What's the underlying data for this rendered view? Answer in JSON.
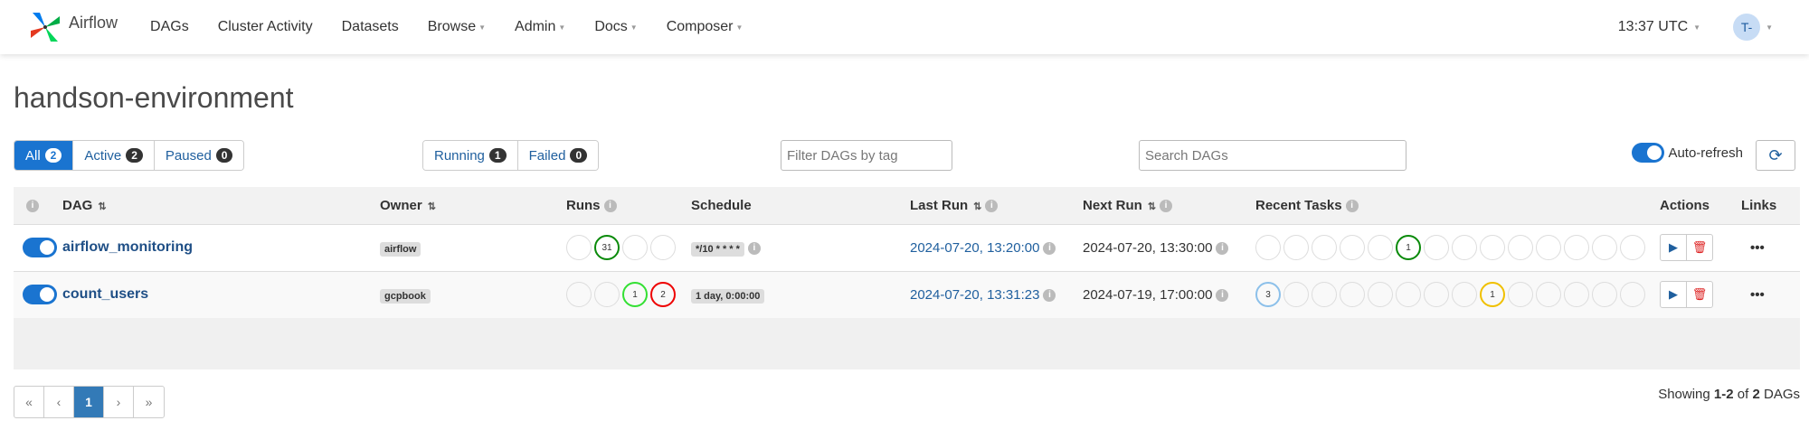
{
  "nav": {
    "brand": "Airflow",
    "items": [
      "DAGs",
      "Cluster Activity",
      "Datasets",
      "Browse",
      "Admin",
      "Docs",
      "Composer"
    ],
    "clock": "13:37 UTC",
    "user_initials": "T-"
  },
  "page_title": "handson-environment",
  "status_filters": [
    {
      "label": "All",
      "count": "2",
      "active": true
    },
    {
      "label": "Active",
      "count": "2"
    },
    {
      "label": "Paused",
      "count": "0"
    }
  ],
  "run_filters": [
    {
      "label": "Running",
      "count": "1"
    },
    {
      "label": "Failed",
      "count": "0"
    }
  ],
  "tag_filter_placeholder": "Filter DAGs by tag",
  "search_placeholder": "Search DAGs",
  "autorefresh_label": "Auto-refresh",
  "columns": {
    "dag": "DAG",
    "owner": "Owner",
    "runs": "Runs",
    "schedule": "Schedule",
    "last_run": "Last Run",
    "next_run": "Next Run",
    "recent_tasks": "Recent Tasks",
    "actions": "Actions",
    "links": "Links"
  },
  "dags": [
    {
      "name": "airflow_monitoring",
      "owner": "airflow",
      "runs": [
        "",
        "31",
        "",
        ""
      ],
      "schedule": "*/10 * * * *",
      "last_run": "2024-07-20, 13:20:00",
      "next_run": "2024-07-20, 13:30:00",
      "recent_tasks": [
        "",
        "",
        "",
        "",
        "",
        "1",
        "",
        "",
        "",
        "",
        "",
        "",
        "",
        ""
      ]
    },
    {
      "name": "count_users",
      "owner": "gcpbook",
      "runs": [
        "",
        "",
        "1",
        "2"
      ],
      "schedule": "1 day, 0:00:00",
      "last_run": "2024-07-20, 13:31:23",
      "next_run": "2024-07-19, 17:00:00",
      "recent_tasks": [
        "3",
        "",
        "",
        "",
        "",
        "",
        "",
        "",
        "1",
        "",
        "",
        "",
        "",
        ""
      ]
    }
  ],
  "pagination": [
    "«",
    "‹",
    "1",
    "›",
    "»"
  ],
  "showing": {
    "prefix": "Showing ",
    "range": "1-2",
    "middle": " of ",
    "total": "2",
    "suffix": " DAGs"
  },
  "colors": {
    "accent": "#1a74d0",
    "success": "#0a8a0a",
    "failed": "#e00000",
    "queued": "#8cc0ea",
    "upstream_failed": "#f0c000",
    "running": "#33e033"
  }
}
